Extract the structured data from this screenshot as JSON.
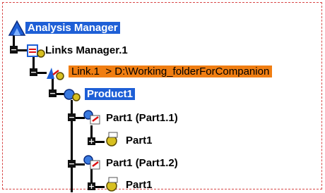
{
  "tree": {
    "root": {
      "label": "Analysis Manager"
    },
    "links_manager": {
      "label": "Links Manager.1"
    },
    "link": {
      "name": "Link.1",
      "path": "  > D:\\Working_folderForCompanion"
    },
    "product": {
      "label": "Product1"
    },
    "part_instance_1": {
      "label": "Part1 (Part1.1)"
    },
    "part_1": {
      "label": "Part1"
    },
    "part_instance_2": {
      "label": "Part1 (Part1.2)"
    },
    "part_2": {
      "label": "Part1"
    }
  },
  "colors": {
    "selection_blue": "#1e5fd6",
    "selection_orange": "#f07e12",
    "frame_dash": "#d84848"
  },
  "icons": [
    "analysis-manager-icon",
    "links-manager-icon",
    "link-icon",
    "product-icon",
    "part-instance-icon",
    "part-icon"
  ]
}
